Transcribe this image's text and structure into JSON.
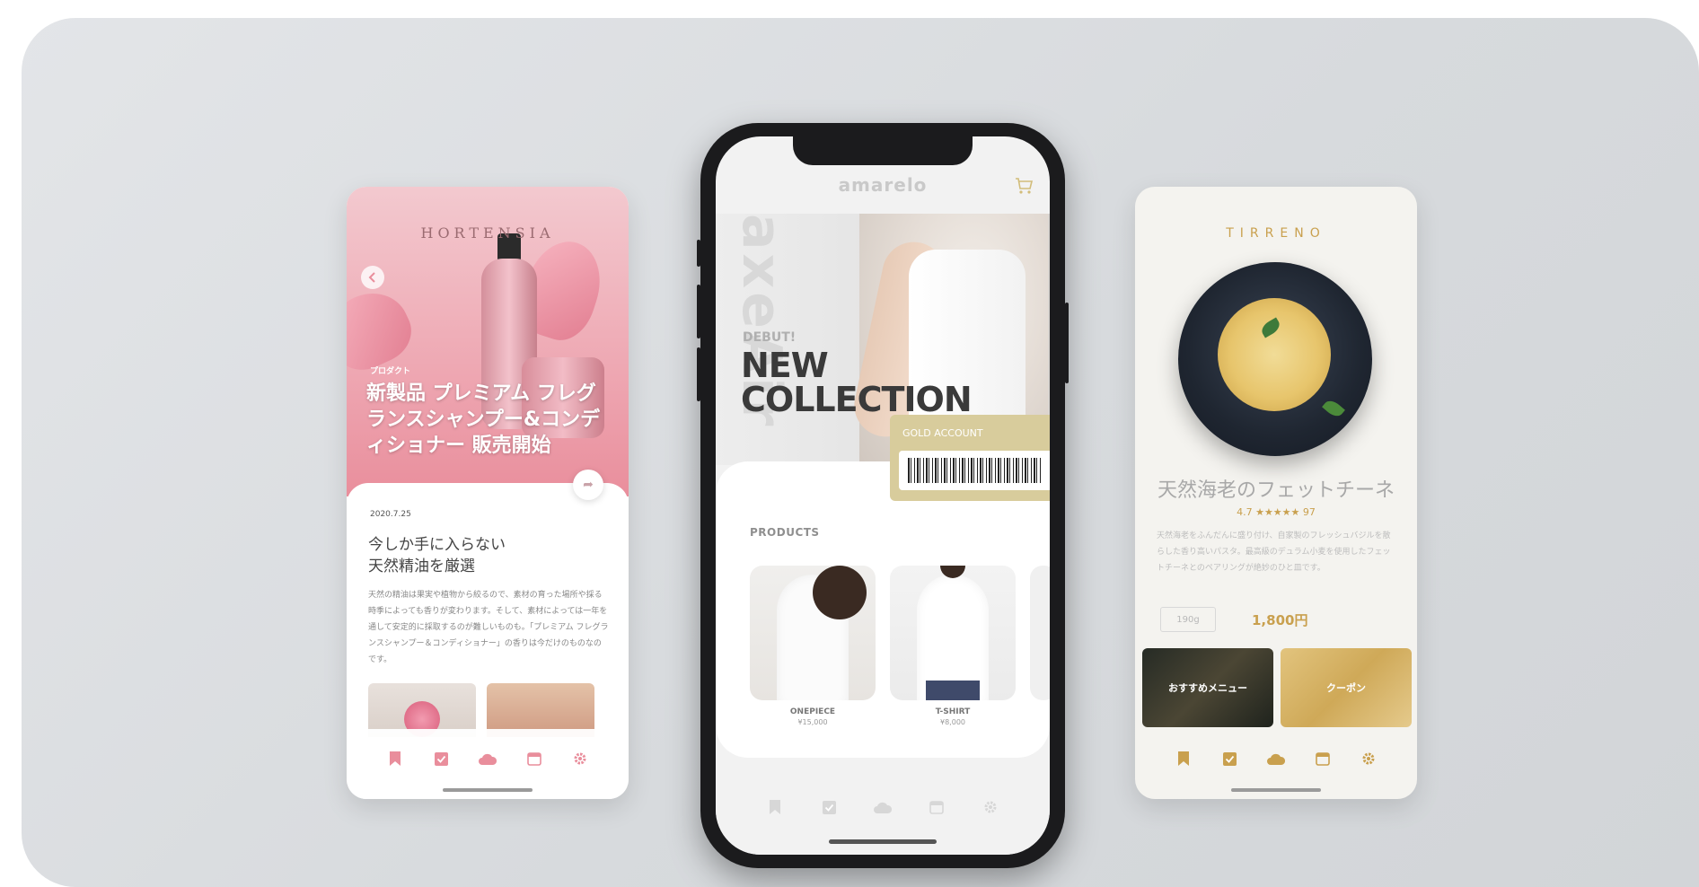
{
  "left_app": {
    "brand": "HORTENSIA",
    "category": "プロダクト",
    "headline": "新製品 プレミアム フレグランスシャンプー&コンディショナー 販売開始",
    "date": "2020.7.25",
    "article_title_line1": "今しか手に入らない",
    "article_title_line2": "天然精油を厳選",
    "article_body": "天然の精油は果実や植物から絞るので、素材の育った場所や採る時季によっても香りが変わります。そして、素材によっては一年を通して安定的に採取するのが難しいものも。「プレミアム フレグランスシャンプー＆コンディショナー」の香りは今だけのものなのです。",
    "accent_color": "#eea7b2"
  },
  "center_app": {
    "logo": "amarelo",
    "hero_vertical_text": "axeAir",
    "debut": "DEBUT!",
    "headline_line1": "NEW",
    "headline_line2": "COLLECTION",
    "gold_label": "GOLD ACCOUNT",
    "products_heading": "PRODUCTS",
    "products": [
      {
        "name": "ONEPIECE",
        "price": "¥15,000"
      },
      {
        "name": "T-SHIRT",
        "price": "¥8,000"
      }
    ],
    "gold_color": "#d8cc9c"
  },
  "right_app": {
    "brand": "TIRRENO",
    "dish_title": "天然海老のフェットチーネ",
    "rating": "4.7 ★★★★★ 97",
    "description": "天然海老をふんだんに盛り付け、自家製のフレッシュバジルを散らした香り高いパスタ。最高級のデュラム小麦を使用したフェットチーネとのペアリングが絶妙のひと皿です。",
    "size": "190g",
    "price": "1,800円",
    "tile_recommend": "おすすめメニュー",
    "tile_coupon": "クーポン",
    "accent_color": "#c9a04e"
  },
  "tabbar_icons": [
    "bookmark-icon",
    "checkbox-icon",
    "cloud-icon",
    "calendar-icon",
    "gear-icon"
  ]
}
